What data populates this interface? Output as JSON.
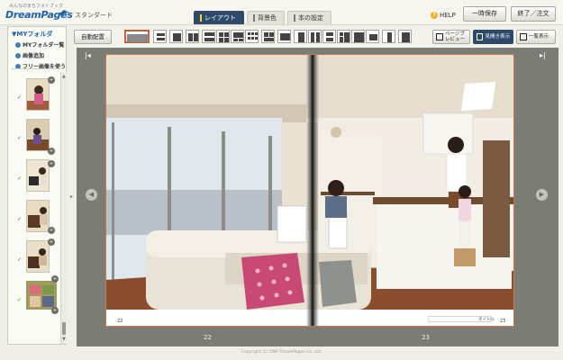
{
  "header": {
    "logo_small": "みんなのまちフォトブック",
    "logo_main": "DreamPages",
    "edition": "スタンダード",
    "tabs": [
      {
        "label": "レイアウト",
        "active": true
      },
      {
        "label": "背景色",
        "active": false
      },
      {
        "label": "本の設定",
        "active": false
      }
    ],
    "help_label": "HELP",
    "save_button": "一時保存",
    "finish_button": "終了／注文"
  },
  "sidebar": {
    "title": "MYフォルダ",
    "items": [
      {
        "label": "MYフォルダ一覧",
        "icon": "list-icon"
      },
      {
        "label": "画像追加",
        "icon": "add-icon"
      },
      {
        "label": "フリー画像を使う",
        "icon": "add-icon"
      }
    ],
    "thumbnails": [
      {
        "subject": "child on chair"
      },
      {
        "subject": "child at table"
      },
      {
        "subject": "child at piano"
      },
      {
        "subject": "child at piano"
      },
      {
        "subject": "child at piano"
      },
      {
        "subject": "collage"
      }
    ]
  },
  "toolbar": {
    "auto_layout_button": "自動配置",
    "layout_count": 18,
    "selected_layout": 0,
    "page_preview_label": "ページプレビュー",
    "spread_view_label": "見開き表示",
    "list_view_label": "一覧表示"
  },
  "editor": {
    "left_page_number": "22",
    "right_page_number": "23",
    "left_page_label_below": "22",
    "right_page_label_below": "23",
    "title_label": "タイトル"
  },
  "footer": {
    "copyright": "Copyright (C) DNP DreamPages Co. Ltd."
  },
  "colors": {
    "accent": "#2d4a6a",
    "brand_blue": "#1f63a8",
    "selection_border": "#c0613a",
    "editor_bg": "#7c7c76"
  }
}
